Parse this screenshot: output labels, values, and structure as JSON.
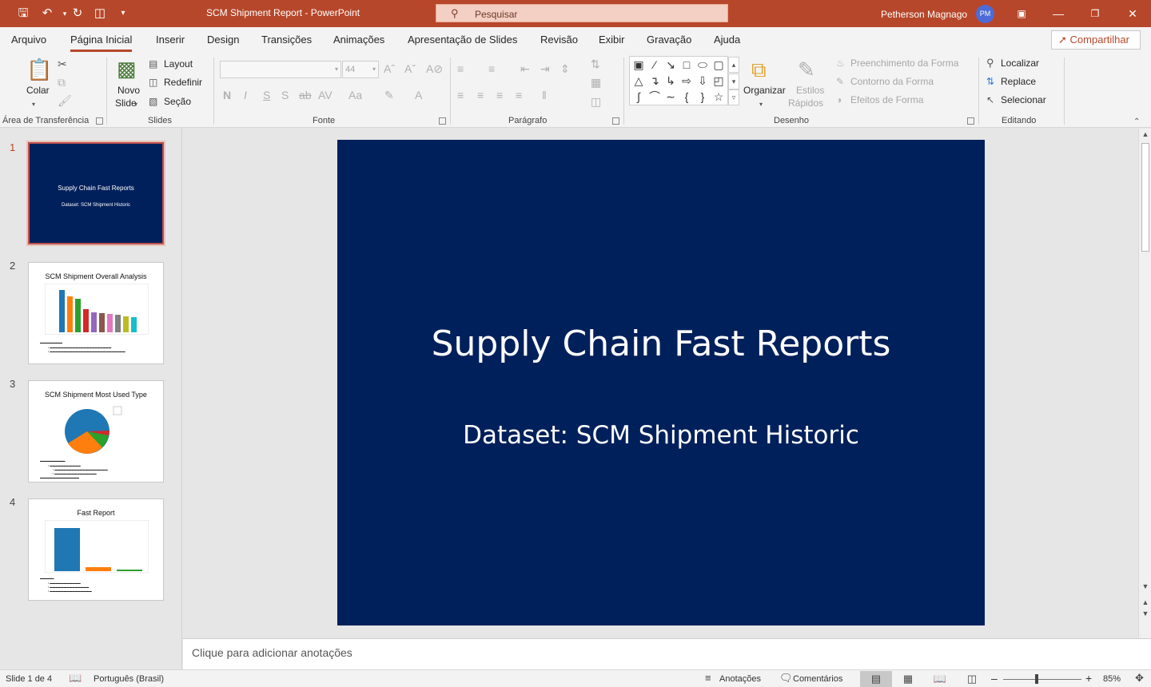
{
  "window": {
    "title": "SCM Shipment Report  -  PowerPoint",
    "search_placeholder": "Pesquisar",
    "user_name": "Petherson Magnago",
    "user_initials": "PM"
  },
  "tabs": [
    "Arquivo",
    "Página Inicial",
    "Inserir",
    "Design",
    "Transições",
    "Animações",
    "Apresentação de Slides",
    "Revisão",
    "Exibir",
    "Gravação",
    "Ajuda"
  ],
  "active_tab": "Página Inicial",
  "share_label": "Compartilhar",
  "ribbon": {
    "clipboard": {
      "paste": "Colar",
      "group": "Área de Transferência"
    },
    "slides": {
      "new_slide_1": "Novo",
      "new_slide_2": "Slide",
      "layout": "Layout",
      "reset": "Redefinir",
      "section": "Seção",
      "group": "Slides"
    },
    "font": {
      "size": "44",
      "group": "Fonte",
      "bold": "N",
      "italic": "I",
      "underline": "S",
      "shadow": "S",
      "strike": "ab",
      "spacing": "AV",
      "case": "Aa"
    },
    "paragraph": {
      "group": "Parágrafo"
    },
    "drawing": {
      "arrange": "Organizar",
      "quick_styles_1": "Estilos",
      "quick_styles_2": "Rápidos",
      "fill": "Preenchimento da Forma",
      "outline": "Contorno da Forma",
      "effects": "Efeitos de Forma",
      "group": "Desenho"
    },
    "editing": {
      "find": "Localizar",
      "replace": "Replace",
      "select": "Selecionar",
      "group": "Editando"
    }
  },
  "slides": [
    {
      "number": "1",
      "title": "Supply Chain Fast Reports",
      "subtitle": "Dataset: SCM Shipment Historic"
    },
    {
      "number": "2",
      "title": "SCM Shipment Overall Analysis"
    },
    {
      "number": "3",
      "title": "SCM Shipment Most Used Type"
    },
    {
      "number": "4",
      "title": "Fast Report"
    }
  ],
  "main_slide": {
    "title": "Supply Chain Fast Reports",
    "subtitle": "Dataset: SCM Shipment Historic"
  },
  "notes_placeholder": "Clique para adicionar anotações",
  "status": {
    "slide_info": "Slide 1 de 4",
    "language": "Português (Brasil)",
    "notes": "Anotações",
    "comments": "Comentários",
    "zoom": "85%"
  },
  "colors": {
    "accent": "#b7472a",
    "slide_background": "#00205b"
  }
}
